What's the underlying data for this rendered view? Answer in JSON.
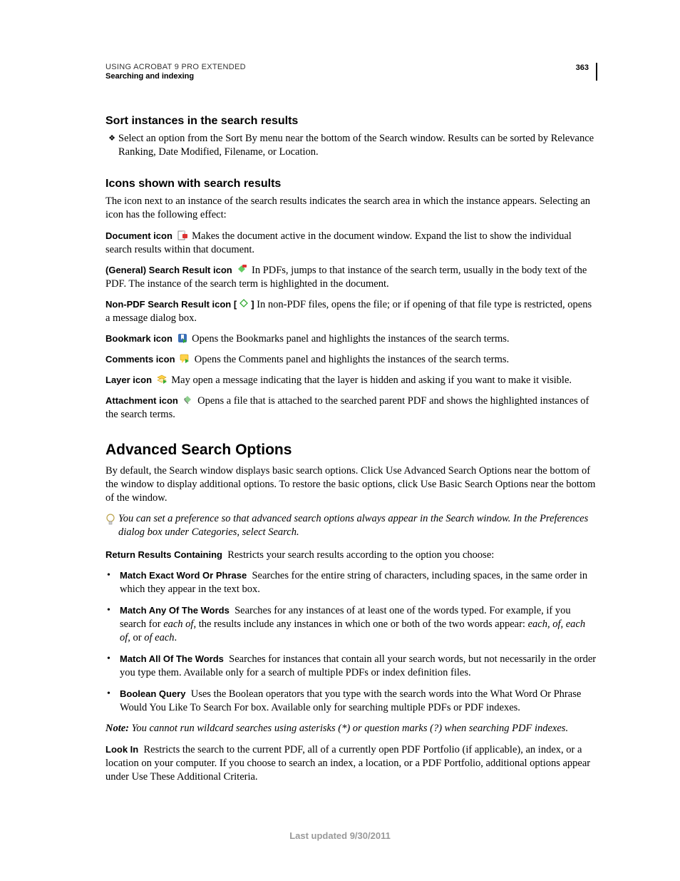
{
  "header": {
    "product": "USING ACROBAT 9 PRO EXTENDED",
    "section": "Searching and indexing",
    "page": "363"
  },
  "sort": {
    "heading": "Sort instances in the search results",
    "bullet": "Select an option from the Sort By menu near the bottom of the Search window. Results can be sorted by Relevance Ranking, Date Modified, Filename, or Location."
  },
  "icons": {
    "heading": "Icons shown with search results",
    "intro": "The icon next to an instance of the search results indicates the search area in which the instance appears. Selecting an icon has the following effect:",
    "defs": {
      "document_term": "Document icon",
      "document_body": "Makes the document active in the document window. Expand the list to show the individual search results within that document.",
      "general_term": "(General) Search Result icon",
      "general_body": "In PDFs, jumps to that instance of the search term, usually in the body text of the PDF. The instance of the search term is highlighted in the document.",
      "nonpdf_term": "Non-PDF Search Result icon",
      "nonpdf_body": "In non-PDF files, opens the file; or if opening of that file type is restricted, opens a message dialog box.",
      "bookmark_term": "Bookmark icon",
      "bookmark_body": "Opens the Bookmarks panel and highlights the instances of the search terms.",
      "comments_term": "Comments icon",
      "comments_body": "Opens the Comments panel and highlights the instances of the search terms.",
      "layer_term": "Layer icon",
      "layer_body": "May open a message indicating that the layer is hidden and asking if you want to make it visible.",
      "attachment_term": "Attachment icon",
      "attachment_body": "Opens a file that is attached to the searched parent PDF and shows the highlighted instances of the search terms."
    }
  },
  "advanced": {
    "heading": "Advanced Search Options",
    "intro": "By default, the Search window displays basic search options. Click Use Advanced Search Options near the bottom of the window to display additional options. To restore the basic options, click Use Basic Search Options near the bottom of the window.",
    "tip": "You can set a preference so that advanced search options always appear in the Search window. In the Preferences dialog box under Categories, select Search.",
    "return_term": "Return Results Containing",
    "return_body": "Restricts your search results according to the option you choose:",
    "matchExact_term": "Match Exact Word Or Phrase",
    "matchExact_body": "Searches for the entire string of characters, including spaces, in the same order in which they appear in the text box.",
    "matchAny_term": "Match Any Of The Words",
    "matchAny_pre": "Searches for any instances of at least one of the words typed. For example, if you search for ",
    "matchAny_em1": "each of",
    "matchAny_mid": ", the results include any instances in which one or both of the two words appear: ",
    "matchAny_em2": "each, of, each of",
    "matchAny_mid2": ", or ",
    "matchAny_em3": "of each",
    "matchAny_end": ".",
    "matchAll_term": "Match All Of The Words",
    "matchAll_body": "Searches for instances that contain all your search words, but not necessarily in the order you type them. Available only for a search of multiple PDFs or index definition files.",
    "boolean_term": "Boolean Query",
    "boolean_body": "Uses the Boolean operators that you type with the search words into the What Word Or Phrase Would You Like To Search For box. Available only for searching multiple PDFs or PDF indexes.",
    "note_label": "Note:",
    "note_body": "You cannot run wildcard searches using asterisks (*) or question marks (?) when searching PDF indexes.",
    "lookin_term": "Look In",
    "lookin_body": "Restricts the search to the current PDF, all of a currently open PDF Portfolio (if applicable), an index, or a location on your computer. If you choose to search an index, a location, or a PDF Portfolio, additional options appear under Use These Additional Criteria."
  },
  "footer": "Last updated 9/30/2011"
}
